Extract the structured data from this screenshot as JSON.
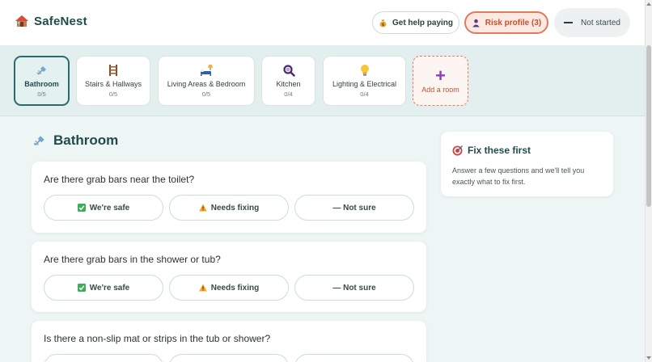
{
  "brand": {
    "name": "SafeNest"
  },
  "header": {
    "help_label": "Get help paying",
    "risk_label": "Risk profile (3)",
    "status_label": "Not started"
  },
  "rooms": [
    {
      "name": "Bathroom",
      "count": "0/5",
      "icon": "shower-icon"
    },
    {
      "name": "Stairs & Hallways",
      "count": "0/5",
      "icon": "ladder-icon"
    },
    {
      "name": "Living Areas & Bedroom",
      "count": "0/5",
      "icon": "bed-lamp-icon"
    },
    {
      "name": "Kitchen",
      "count": "0/4",
      "icon": "magnifier-icon"
    },
    {
      "name": "Lighting & Electrical",
      "count": "0/4",
      "icon": "lightbulb-icon"
    }
  ],
  "add_room": {
    "label": "Add a room"
  },
  "section": {
    "title": "Bathroom"
  },
  "questions": [
    {
      "text": "Are there grab bars near the toilet?"
    },
    {
      "text": "Are there grab bars in the shower or tub?"
    },
    {
      "text": "Is there a non-slip mat or strips in the tub or shower?"
    }
  ],
  "options": {
    "safe": "We're safe",
    "fix": "Needs fixing",
    "unsure": "— Not sure"
  },
  "side_card": {
    "title": "Fix these first",
    "description": "Answer a few questions and we'll tell you exactly what to fix first."
  },
  "colors": {
    "accent": "#2b6b6e",
    "risk": "#e27b5c",
    "add": "#8a3fb8"
  }
}
